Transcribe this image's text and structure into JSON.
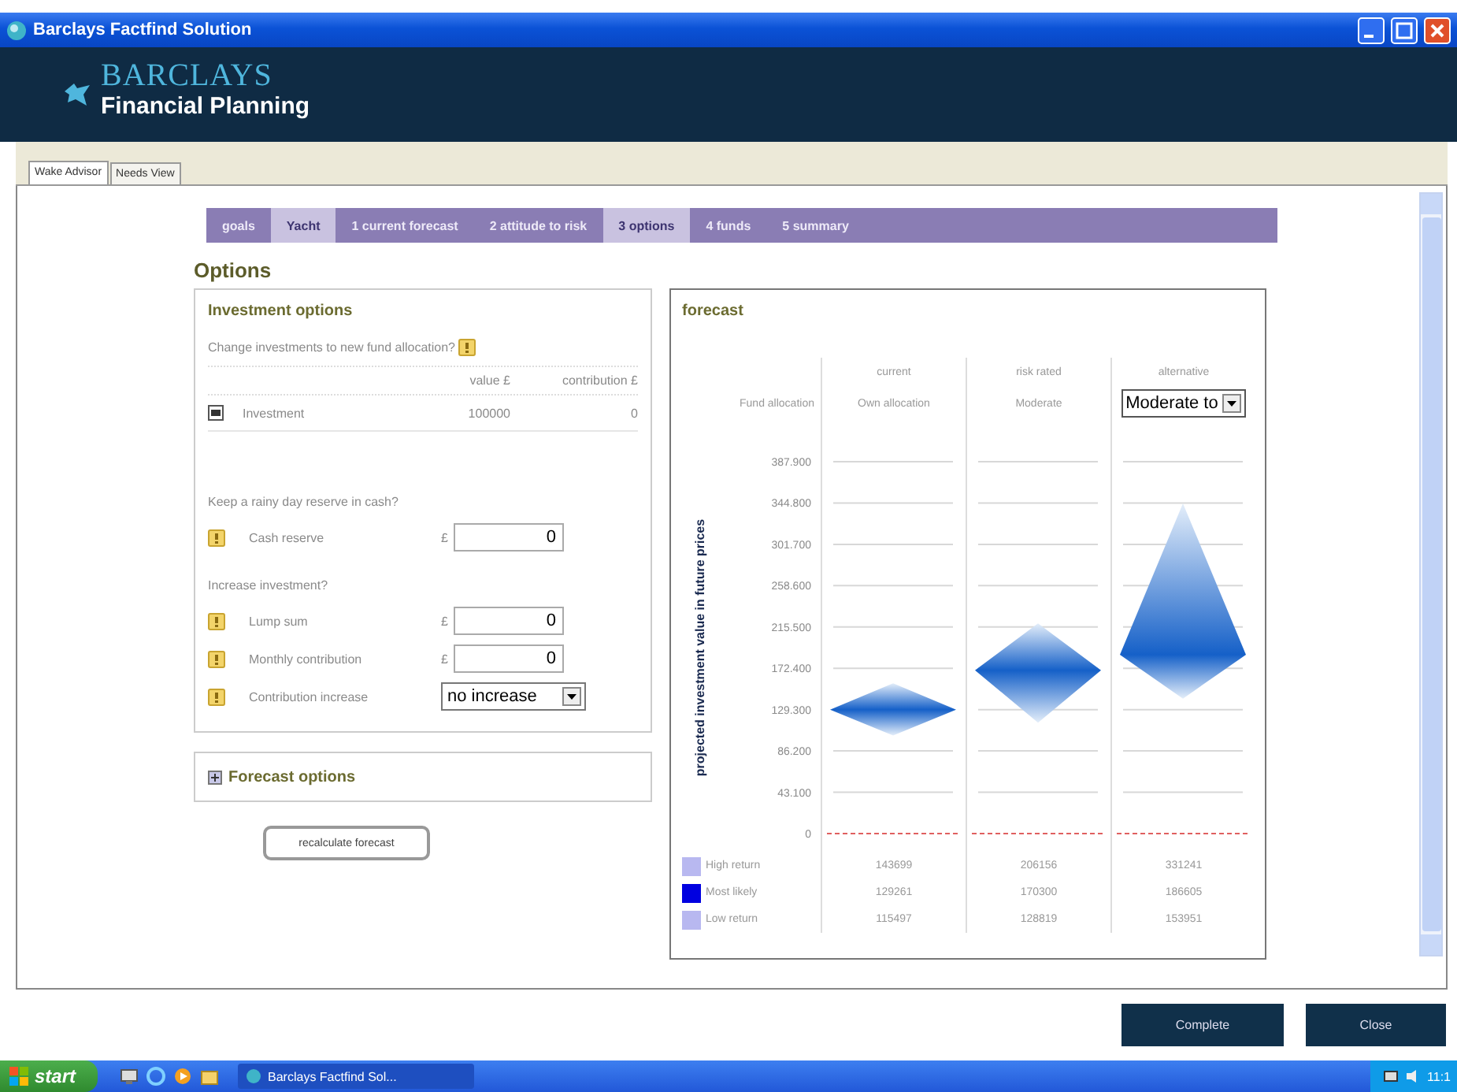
{
  "window": {
    "title": "Barclays Factfind Solution"
  },
  "header": {
    "brand": "BARCLAYS",
    "subtitle": "Financial Planning"
  },
  "tabs": [
    {
      "label": "Wake Advisor",
      "selected": true
    },
    {
      "label": "Needs View",
      "selected": false
    }
  ],
  "steps": [
    {
      "label": "goals",
      "selected": false
    },
    {
      "label": "Yacht",
      "selected": true
    },
    {
      "label": "1 current forecast",
      "selected": false
    },
    {
      "label": "2 attitude to risk",
      "selected": false
    },
    {
      "label": "3 options",
      "selected": true
    },
    {
      "label": "4 funds",
      "selected": false
    },
    {
      "label": "5 summary",
      "selected": false
    }
  ],
  "page_title": "Options",
  "investment_options": {
    "title": "Investment options",
    "question": "Change investments to new fund allocation?",
    "columns": [
      "value £",
      "contribution £"
    ],
    "rows": [
      {
        "name": "Investment",
        "checked": true,
        "value": "100000",
        "contribution": "0"
      }
    ]
  },
  "sections": [
    {
      "question": "Keep a rainy day reserve in cash?",
      "fields": [
        {
          "kind": "input",
          "label": "Cash reserve",
          "currency": "£",
          "value": "0"
        }
      ]
    },
    {
      "question": "Increase investment?",
      "fields": [
        {
          "kind": "input",
          "label": "Lump sum",
          "currency": "£",
          "value": "0"
        },
        {
          "kind": "input",
          "label": "Monthly contribution",
          "currency": "£",
          "value": "0"
        },
        {
          "kind": "select",
          "label": "Contribution increase",
          "value": "no increase"
        }
      ]
    }
  ],
  "forecast_options": {
    "label": "Forecast options",
    "expanded": false
  },
  "recalculate_button": "recalculate forecast",
  "forecast": {
    "title": "forecast",
    "row_label": "Fund allocation",
    "columns": [
      {
        "kind": "text",
        "heading": "current",
        "allocation": "Own allocation"
      },
      {
        "kind": "text",
        "heading": "risk rated",
        "allocation": "Moderate"
      },
      {
        "kind": "select",
        "heading": "alternative",
        "allocation": "Moderate to"
      }
    ],
    "y_axis": {
      "title": "projected investment value in future prices",
      "ticks": [
        "387.900",
        "344.800",
        "301.700",
        "258.600",
        "215.500",
        "172.400",
        "129.300",
        "86.200",
        "43.100",
        "0"
      ]
    },
    "legend": [
      {
        "label": "High return",
        "color": "#b8b8f0"
      },
      {
        "label": "Most likely",
        "color": "#0000e0"
      },
      {
        "label": "Low return",
        "color": "#b8b8f0"
      }
    ],
    "value_rows": [
      [
        "143699",
        "206156",
        "331241"
      ],
      [
        "129261",
        "170300",
        "186605"
      ],
      [
        "115497",
        "128819",
        "153951"
      ]
    ]
  },
  "buttons": [
    "Complete",
    "Close"
  ],
  "taskbar": {
    "start": "start",
    "tasks": [
      {
        "label": "Barclays Factfind Sol...",
        "selected": true
      }
    ],
    "clock": "11:1"
  }
}
